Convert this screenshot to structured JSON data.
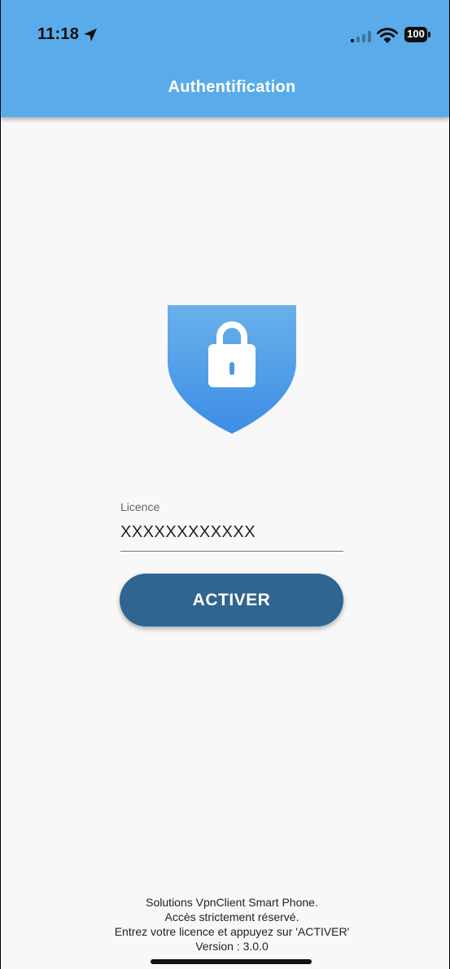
{
  "status_bar": {
    "time": "11:18",
    "battery": "100"
  },
  "header": {
    "title": "Authentification"
  },
  "form": {
    "licence_label": "Licence",
    "licence_value": "XXXXXXXXXXXX",
    "activate_label": "ACTIVER"
  },
  "footer": {
    "line1": "Solutions VpnClient Smart Phone.",
    "line2": "Accès strictement réservé.",
    "line3": "Entrez votre licence et appuyez sur 'ACTIVER'",
    "line4": "Version : 3.0.0"
  },
  "colors": {
    "header": "#5aabea",
    "button": "#2f6590",
    "shield_top": "#69b0ea",
    "shield_bottom": "#3d8de6"
  }
}
